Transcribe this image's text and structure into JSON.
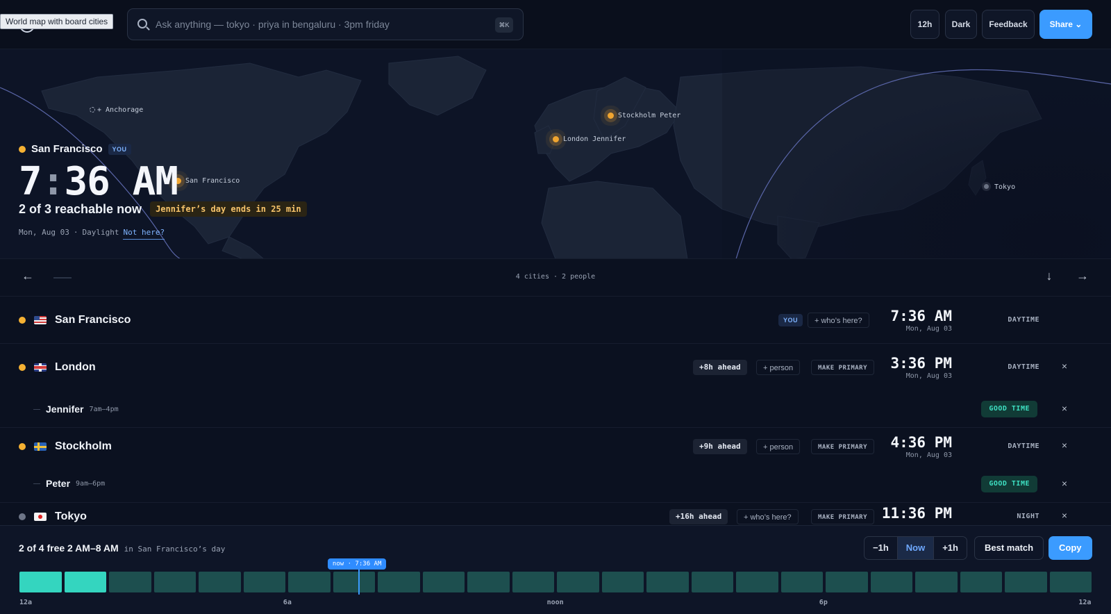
{
  "tooltip": "World map with board cities",
  "search": {
    "placeholder": "Ask anything — tokyo · priya in bengaluru · 3pm friday",
    "shortcut": "⌘K"
  },
  "toolbar": {
    "format_label": "12h",
    "theme_label": "Dark",
    "feedback_label": "Feedback",
    "share_label": "Share ⌄"
  },
  "map": {
    "pins": [
      {
        "label": "+ Anchorage",
        "style": "hollow"
      },
      {
        "label": "Stockholm Peter",
        "style": "active"
      },
      {
        "label": "London Jennifer",
        "style": "active"
      },
      {
        "label": "San Francisco",
        "style": "active"
      },
      {
        "label": "Tokyo",
        "style": "dim"
      }
    ]
  },
  "home": {
    "city": "San Francisco",
    "badge": "YOU",
    "time_hour": "7",
    "time_min": "36",
    "time_ampm": "AM",
    "reachable": "2 of 3 reachable now",
    "warning": "Jennifer’s day ends in 25 min",
    "date": "Mon, Aug 03",
    "sep": "·",
    "phase": "Daylight",
    "not_here": "Not here?"
  },
  "list": {
    "summary": "4 cities · 2 people",
    "prev_icon": "←",
    "down_icon": "↓",
    "next_icon": "→"
  },
  "rows": [
    {
      "city": "San Francisco",
      "flag": "us",
      "dot": "amber",
      "badge": "YOU",
      "who": "+ who’s here?",
      "time": "7:36 AM",
      "date": "Mon, Aug 03",
      "phase": "DAYTIME"
    },
    {
      "city": "London",
      "flag": "gb",
      "dot": "amber",
      "ahead": "+8h ahead",
      "add": "+ person",
      "make_primary": "MAKE PRIMARY",
      "time": "3:36 PM",
      "date": "Mon, Aug 03",
      "phase": "DAYTIME",
      "close": "×",
      "person": {
        "name": "Jennifer",
        "hours": "7am–4pm",
        "status": "GOOD TIME",
        "close": "×"
      }
    },
    {
      "city": "Stockholm",
      "flag": "se",
      "dot": "amber",
      "ahead": "+9h ahead",
      "add": "+ person",
      "make_primary": "MAKE PRIMARY",
      "time": "4:36 PM",
      "date": "Mon, Aug 03",
      "phase": "DAYTIME",
      "close": "×",
      "person": {
        "name": "Peter",
        "hours": "9am–6pm",
        "status": "GOOD TIME",
        "close": "×"
      }
    },
    {
      "city": "Tokyo",
      "flag": "jp",
      "dot": "grey",
      "ahead": "+16h ahead",
      "who": "+ who’s here?",
      "make_primary": "MAKE PRIMARY",
      "time": "11:36 PM",
      "phase": "NIGHT",
      "close": "×"
    }
  ],
  "planner": {
    "free_summary": "2 of 4 free 2 AM–8 AM",
    "context": "in San Francisco’s day",
    "minus": "−1h",
    "now": "Now",
    "plus": "+1h",
    "best": "Best match",
    "copy": "Copy",
    "now_tag": "now · 7:36 AM",
    "now_hour": 7.6,
    "hours_free": [
      true,
      true,
      false,
      false,
      false,
      false,
      false,
      false,
      false,
      false,
      false,
      false,
      false,
      false,
      false,
      false,
      false,
      false,
      false,
      false,
      false,
      false,
      false,
      false
    ],
    "ticks": [
      "12a",
      "6a",
      "noon",
      "6p",
      "12a"
    ]
  },
  "colors": {
    "accent": "#3b9bff",
    "amber": "#f5b133",
    "good": "#3ee0c2",
    "free": "#34d5bf",
    "busy": "#1d4f4f"
  }
}
